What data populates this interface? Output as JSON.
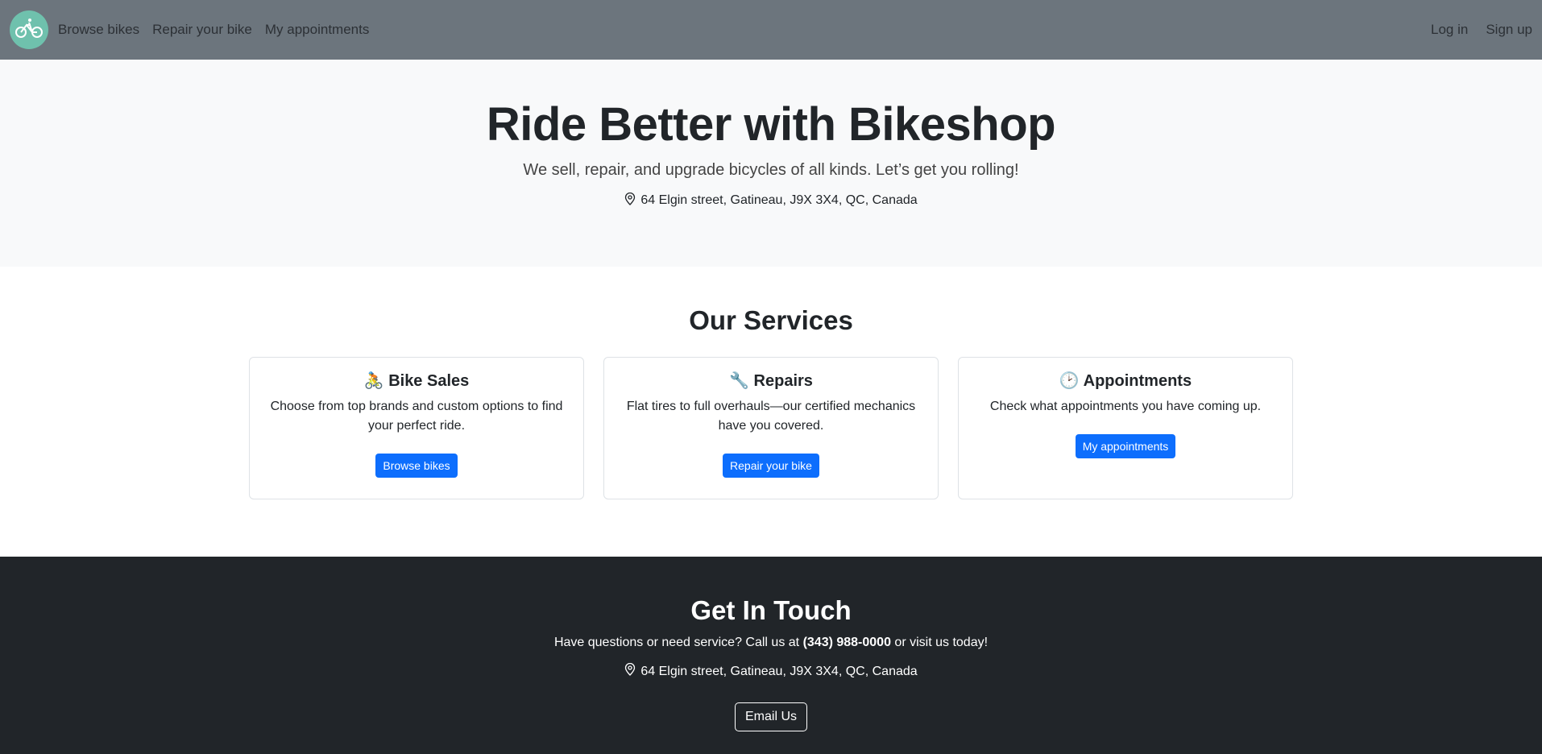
{
  "nav": {
    "logo_icon": "bicycle-icon",
    "links": [
      "Browse bikes",
      "Repair your bike",
      "My appointments"
    ],
    "login": "Log in",
    "signup": "Sign up"
  },
  "hero": {
    "title": "Ride Better with Bikeshop",
    "lead": "We sell, repair, and upgrade bicycles of all kinds. Let’s get you rolling!",
    "address": "64 Elgin street, Gatineau, J9X 3X4, QC, Canada"
  },
  "services": {
    "heading": "Our Services",
    "cards": [
      {
        "emoji": "🚴",
        "title": "Bike Sales",
        "text": "Choose from top brands and custom options to find your perfect ride.",
        "button": "Browse bikes"
      },
      {
        "emoji": "🔧",
        "title": "Repairs",
        "text": "Flat tires to full overhauls—our certified mechanics have you covered.",
        "button": "Repair your bike"
      },
      {
        "emoji": "🕑",
        "title": "Appointments",
        "text": "Check what appointments you have coming up.",
        "button": "My appointments"
      }
    ]
  },
  "contact": {
    "heading": "Get In Touch",
    "text_before": "Have questions or need service? Call us at ",
    "phone": "(343) 988-0000",
    "text_after": " or visit us today!",
    "address": "64 Elgin street, Gatineau, J9X 3X4, QC, Canada",
    "email_button": "Email Us"
  },
  "colors": {
    "navbar": "#6c757d",
    "logo": "#6fc1ad",
    "primary": "#0d6efd",
    "footer": "#212529"
  }
}
